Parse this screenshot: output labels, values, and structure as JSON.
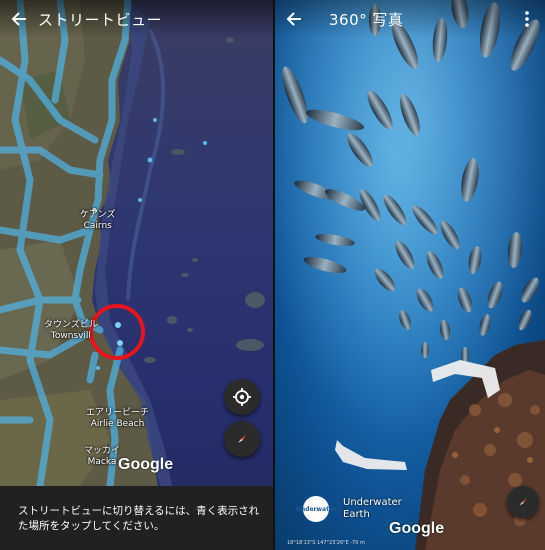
{
  "left_panel": {
    "title": "ストリートビュー",
    "back_icon": "arrow-left-icon",
    "labels": {
      "cairns_jp": "ケアンズ",
      "cairns_en": "Cairns",
      "townsville_jp": "タウンズビル",
      "townsville_en": "Townsvill",
      "airlie_jp": "エアリービーチ",
      "airlie_en": "Airlie Beach",
      "mackay_jp": "マッカイ",
      "mackay_en": "Macka"
    },
    "google_logo": "Google",
    "location_button_icon": "my-location-icon",
    "compass_button_icon": "compass-icon",
    "info_text": "ストリートビューに切り替えるには、青く表示された場所をタップしてください。",
    "colors": {
      "coverage_line": "#4fb6ea",
      "highlight_circle": "#e8141b"
    }
  },
  "right_panel": {
    "title": "360° 写真",
    "back_icon": "arrow-left-icon",
    "menu_icon": "more-vert-icon",
    "attribution_logo_text": "Underwater",
    "attribution_name_line1": "Underwater",
    "attribution_name_line2": "Earth",
    "google_logo": "Google",
    "coordinates": "18°18'13\"S 147°23'26\"E -70 m",
    "compass_button_icon": "compass-icon"
  }
}
